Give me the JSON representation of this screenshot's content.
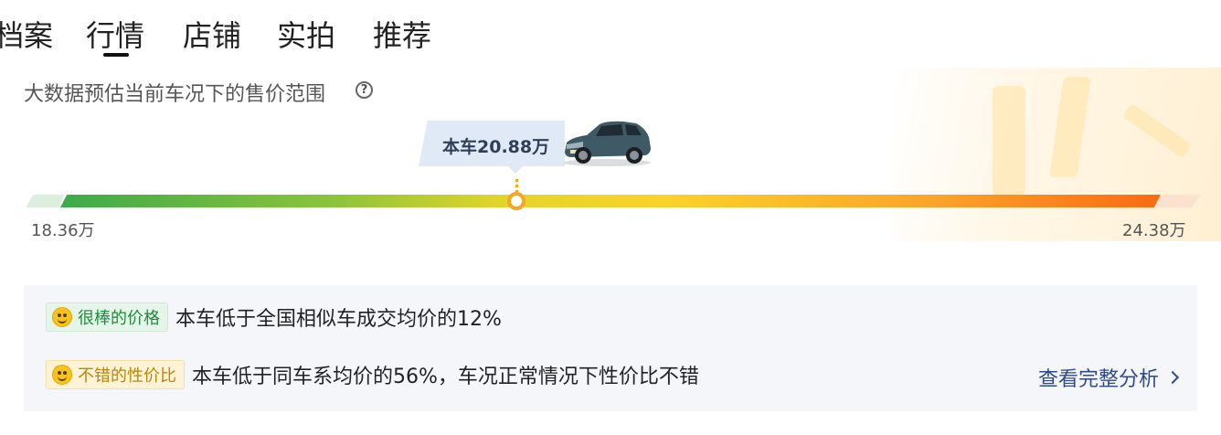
{
  "tabs": [
    "档案",
    "行情",
    "店铺",
    "实拍",
    "推荐"
  ],
  "active_tab": "行情",
  "estimate": {
    "title": "大数据预估当前车况下的售价范围",
    "current_price_label": "本车20.88万",
    "current_price": 20.88,
    "min_label": "18.36万",
    "max_label": "24.38万",
    "min": 18.36,
    "max": 24.38
  },
  "analysis": {
    "rows": [
      {
        "badge": "很棒的价格",
        "badge_color": "#1f8a3c",
        "text": "本车低于全国相似车成交均价的12%"
      },
      {
        "badge": "不错的性价比",
        "badge_color": "#b8860b",
        "text": "本车低于同车系均价的56%，车况正常情况下性价比不错"
      }
    ],
    "link_label": "查看完整分析"
  },
  "colors": {
    "bar_start": "#3daa4a",
    "bar_end": "#f96b12",
    "marker": "#f5a623",
    "link": "#2f4a8a"
  }
}
